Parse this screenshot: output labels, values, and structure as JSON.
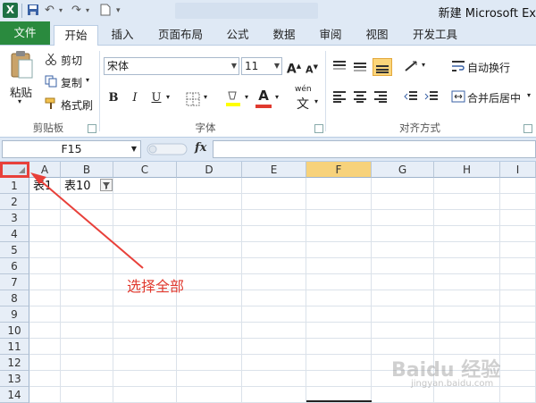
{
  "app": {
    "title": "新建 Microsoft Ex",
    "logo_letter": "X"
  },
  "tabs": [
    {
      "label": "文件"
    },
    {
      "label": "开始"
    },
    {
      "label": "插入"
    },
    {
      "label": "页面布局"
    },
    {
      "label": "公式"
    },
    {
      "label": "数据"
    },
    {
      "label": "审阅"
    },
    {
      "label": "视图"
    },
    {
      "label": "开发工具"
    }
  ],
  "clipboard": {
    "paste": "粘贴",
    "cut": "剪切",
    "copy": "复制",
    "format_painter": "格式刷",
    "group_label": "剪贴板"
  },
  "font": {
    "name": "宋体",
    "size": "11",
    "bold": "B",
    "italic": "I",
    "underline": "U",
    "grow": "A",
    "shrink": "A",
    "wen": "wén",
    "wen_char": "文",
    "color_letter": "A",
    "group_label": "字体",
    "font_color": "#e03a2f",
    "highlight_color": "#ffff00"
  },
  "alignment": {
    "wrap_text": "自动换行",
    "merge_center": "合并后居中",
    "group_label": "对齐方式"
  },
  "formula_bar": {
    "name_box": "F15",
    "fx": "fx",
    "formula": ""
  },
  "sheet": {
    "columns": [
      "A",
      "B",
      "C",
      "D",
      "E",
      "F",
      "G",
      "H",
      "I"
    ],
    "selected_column": "F",
    "rows": [
      "1",
      "2",
      "3",
      "4",
      "5",
      "6",
      "7",
      "8",
      "9",
      "10",
      "11",
      "12",
      "13",
      "14"
    ],
    "cells": {
      "A1": "表1",
      "B1": "表10"
    }
  },
  "annotation": {
    "text": "选择全部",
    "color": "#e03a2f"
  },
  "watermark": {
    "brand": "Baidu 经验",
    "sub": "jingyan.baidu.com"
  }
}
